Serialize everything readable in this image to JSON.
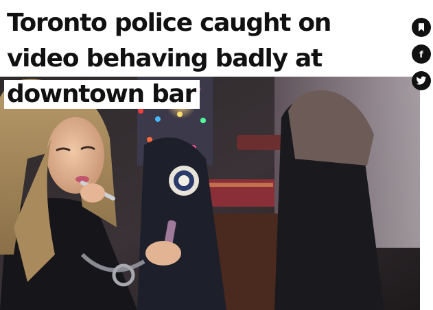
{
  "article": {
    "headline": "Toronto police caught on video behaving badly at downtown bar",
    "photo_alt": "Woman applying lip gloss in a bar while wearing a Toronto Police uniform jacket and handcuffs"
  },
  "share": {
    "bookmark_icon": "bookmark-icon",
    "facebook_icon": "facebook-icon",
    "facebook_glyph": "f",
    "twitter_icon": "twitter-icon"
  },
  "colors": {
    "share_bg": "#111111",
    "headline_bg": "#ffffff",
    "headline_text": "#111111"
  }
}
